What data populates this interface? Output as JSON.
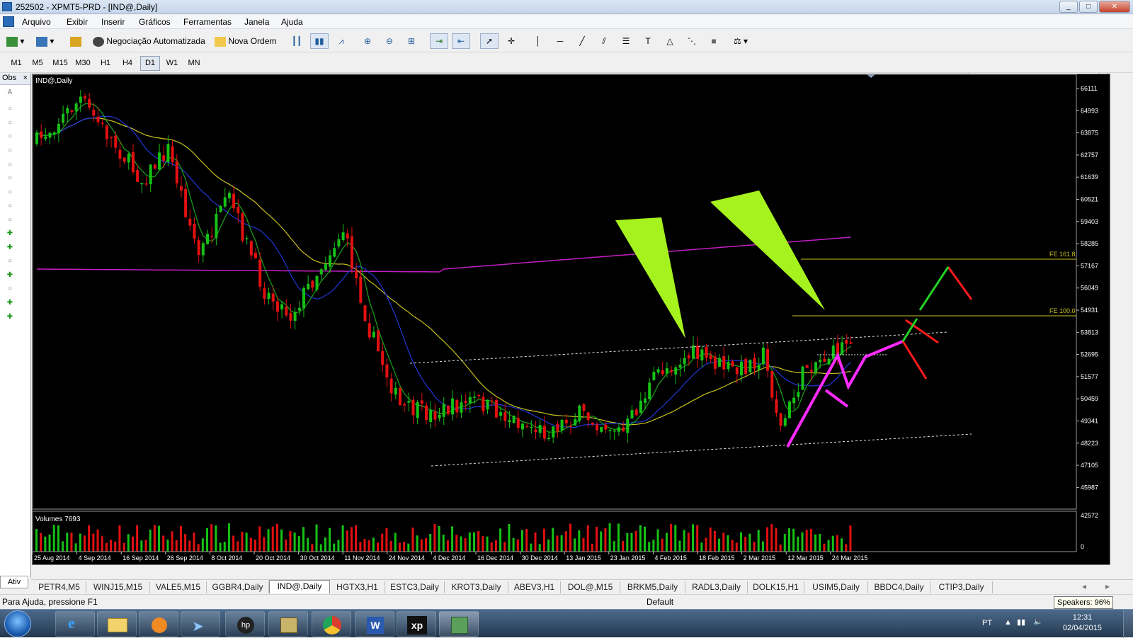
{
  "window": {
    "title": "252502 - XPMT5-PRD - [IND@,Daily]"
  },
  "menu": [
    "Arquivo",
    "Exibir",
    "Inserir",
    "Gráficos",
    "Ferramentas",
    "Janela",
    "Ajuda"
  ],
  "toolbar": {
    "algo_label": "Negociação Automatizada",
    "new_order_label": "Nova Ordem",
    "search_placeholder": ""
  },
  "timeframes": [
    "M1",
    "M5",
    "M15",
    "M30",
    "H1",
    "H4",
    "D1",
    "W1",
    "MN"
  ],
  "selected_timeframe": "D1",
  "observer": {
    "title": "Obs",
    "close": "×",
    "tab": "Ativ"
  },
  "chart": {
    "symbol_label": "IND@,Daily",
    "volume_label": "Volumes 7693",
    "price_ticks": [
      "66111",
      "64993",
      "63875",
      "62757",
      "61639",
      "60521",
      "59403",
      "58285",
      "57167",
      "56049",
      "54931",
      "53813",
      "52695",
      "51577",
      "50459",
      "49341",
      "48223",
      "47105",
      "45987"
    ],
    "volume_ticks": [
      "42572",
      "0"
    ],
    "date_ticks": [
      "25 Aug 2014",
      "4 Sep 2014",
      "16 Sep 2014",
      "26 Sep 2014",
      "8 Oct 2014",
      "20 Oct 2014",
      "30 Oct 2014",
      "11 Nov 2014",
      "24 Nov 2014",
      "4 Dec 2014",
      "16 Dec 2014",
      "30 Dec 2014",
      "13 Jan 2015",
      "23 Jan 2015",
      "4 Feb 2015",
      "18 Feb 2015",
      "2 Mar 2015",
      "12 Mar 2015",
      "24 Mar 2015"
    ],
    "fe_labels": {
      "fe161": "FE 161.8",
      "fe100": "FE 100.0"
    },
    "colors": {
      "bull": "#16c116",
      "bear": "#e31010",
      "ma_fast": "#1aa51a",
      "ma_mid": "#2336d6",
      "ma_slow": "#c8c020",
      "ma_long": "#c21fc2",
      "zigzag": "#ff2bff",
      "arrow": "#a6f21e",
      "fe": "#c8c020"
    }
  },
  "symbol_tabs": [
    "PETR4,M5",
    "WINJ15,M15",
    "VALE5,M15",
    "GGBR4,Daily",
    "IND@,Daily",
    "HGTX3,H1",
    "ESTC3,Daily",
    "KROT3,Daily",
    "ABEV3,H1",
    "DOL@,M15",
    "BRKM5,Daily",
    "RADL3,Daily",
    "DOLK15,H1",
    "USIM5,Daily",
    "BBDC4,Daily",
    "CTIP3,Daily"
  ],
  "active_tab": "IND@,Daily",
  "status": {
    "help": "Para Ajuda, pressione F1",
    "profile": "Default"
  },
  "tooltip": "Speakers: 96%",
  "taskbar": {
    "lang": "PT",
    "time": "12:31",
    "date": "02/04/2015"
  }
}
